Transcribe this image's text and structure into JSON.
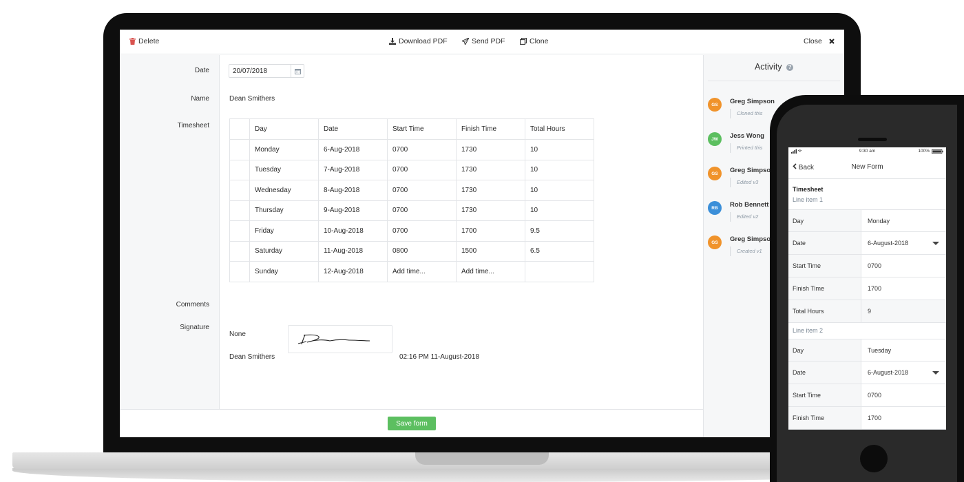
{
  "toolbar": {
    "delete": "Delete",
    "download_pdf": "Download PDF",
    "send_pdf": "Send PDF",
    "clone": "Clone",
    "close": "Close"
  },
  "form": {
    "labels": {
      "date": "Date",
      "name": "Name",
      "timesheet": "Timesheet",
      "comments": "Comments",
      "signature": "Signature"
    },
    "date_value": "20/07/2018",
    "name_value": "Dean Smithers",
    "comments_value": "None",
    "signature": {
      "name": "Dean Smithers",
      "timestamp": "02:16 PM 11-August-2018"
    },
    "save_label": "Save form"
  },
  "timesheet": {
    "headers": [
      "Day",
      "Date",
      "Start Time",
      "Finish Time",
      "Total Hours"
    ],
    "rows": [
      {
        "day": "Monday",
        "date": "6-Aug-2018",
        "start": "0700",
        "finish": "1730",
        "total": "10"
      },
      {
        "day": "Tuesday",
        "date": "7-Aug-2018",
        "start": "0700",
        "finish": "1730",
        "total": "10"
      },
      {
        "day": "Wednesday",
        "date": "8-Aug-2018",
        "start": "0700",
        "finish": "1730",
        "total": "10"
      },
      {
        "day": "Thursday",
        "date": "9-Aug-2018",
        "start": "0700",
        "finish": "1730",
        "total": "10"
      },
      {
        "day": "Friday",
        "date": "10-Aug-2018",
        "start": "0700",
        "finish": "1700",
        "total": "9.5"
      },
      {
        "day": "Saturday",
        "date": "11-Aug-2018",
        "start": "0800",
        "finish": "1500",
        "total": "6.5"
      },
      {
        "day": "Sunday",
        "date": "12-Aug-2018",
        "start": "",
        "finish": "",
        "total": ""
      }
    ],
    "add_time_placeholder": "Add time..."
  },
  "activity": {
    "title": "Activity",
    "entries": [
      {
        "initials": "GS",
        "name": "Greg Simpson",
        "action": "Cloned this",
        "color": "#f0932b"
      },
      {
        "initials": "JW",
        "name": "Jess Wong",
        "action": "Printed this",
        "color": "#5cbf60"
      },
      {
        "initials": "GS",
        "name": "Greg Simpson",
        "action": "Edited v3",
        "color": "#f0932b"
      },
      {
        "initials": "RB",
        "name": "Rob Bennett",
        "action": "Edited v2",
        "color": "#3b8fd9"
      },
      {
        "initials": "GS",
        "name": "Greg Simpson",
        "action": "Created v1",
        "color": "#f0932b"
      }
    ]
  },
  "phone": {
    "status_time": "9:30 am",
    "battery": "100%",
    "back": "Back",
    "title": "New Form",
    "section_title": "Timesheet",
    "line_item_1": "Line item 1",
    "line_item_2": "Line item 2",
    "item1": [
      {
        "label": "Day",
        "value": "Monday"
      },
      {
        "label": "Date",
        "value": "6-August-2018"
      },
      {
        "label": "Start Time",
        "value": "0700"
      },
      {
        "label": "Finish Time",
        "value": "1700"
      },
      {
        "label": "Total Hours",
        "value": "9"
      }
    ],
    "item2": [
      {
        "label": "Day",
        "value": "Tuesday"
      },
      {
        "label": "Date",
        "value": "6-August-2018"
      },
      {
        "label": "Start Time",
        "value": "0700"
      },
      {
        "label": "Finish Time",
        "value": "1700"
      }
    ]
  },
  "colors": {
    "accent_green": "#5cbf60",
    "delete_red": "#d9534f",
    "orange": "#f0932b",
    "blue": "#3b8fd9"
  }
}
